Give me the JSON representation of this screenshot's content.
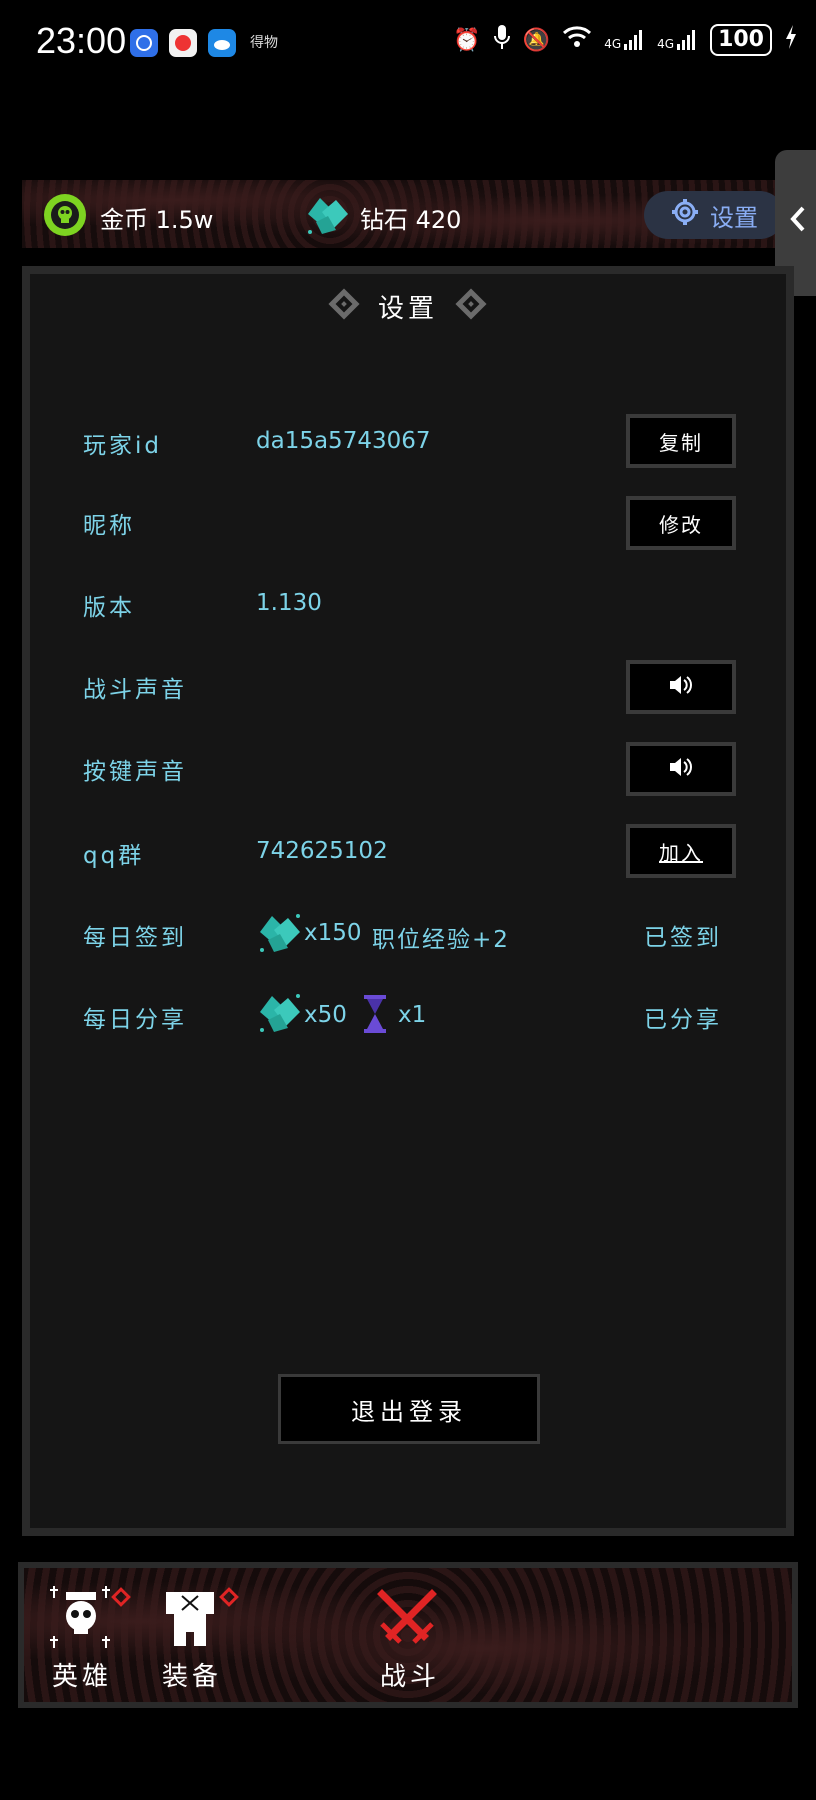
{
  "status_bar": {
    "time": "23:00",
    "small_text": "得物",
    "battery": "100",
    "network_1": "4G",
    "network_2": "4G"
  },
  "resources": {
    "gold_label": "金币 1.5w",
    "diamond_label": "钻石 420",
    "settings_button": "设置"
  },
  "panel": {
    "title": "设置",
    "rows": [
      {
        "label": "玩家id",
        "value": "da15a5743067",
        "button": "复制"
      },
      {
        "label": "昵称",
        "value": "",
        "button": "修改"
      },
      {
        "label": "版本",
        "value": "1.130"
      },
      {
        "label": "战斗声音",
        "button_icon": "speaker-icon"
      },
      {
        "label": "按键声音",
        "button_icon": "speaker-icon"
      },
      {
        "label": "qq群",
        "value": "742625102",
        "button": "加入"
      }
    ],
    "daily_checkin": {
      "label": "每日签到",
      "diamonds": "x150",
      "extra": "职位经验+2",
      "status": "已签到"
    },
    "daily_share": {
      "label": "每日分享",
      "diamonds": "x50",
      "hourglass": "x1",
      "status": "已分享"
    },
    "logout": "退出登录"
  },
  "nav": {
    "heroes": "英雄",
    "equipment": "装备",
    "battle": "战斗"
  },
  "colors": {
    "accent_text": "#7dd3e8",
    "settings_pill": "#2b3344",
    "battle_red": "#e02424"
  }
}
